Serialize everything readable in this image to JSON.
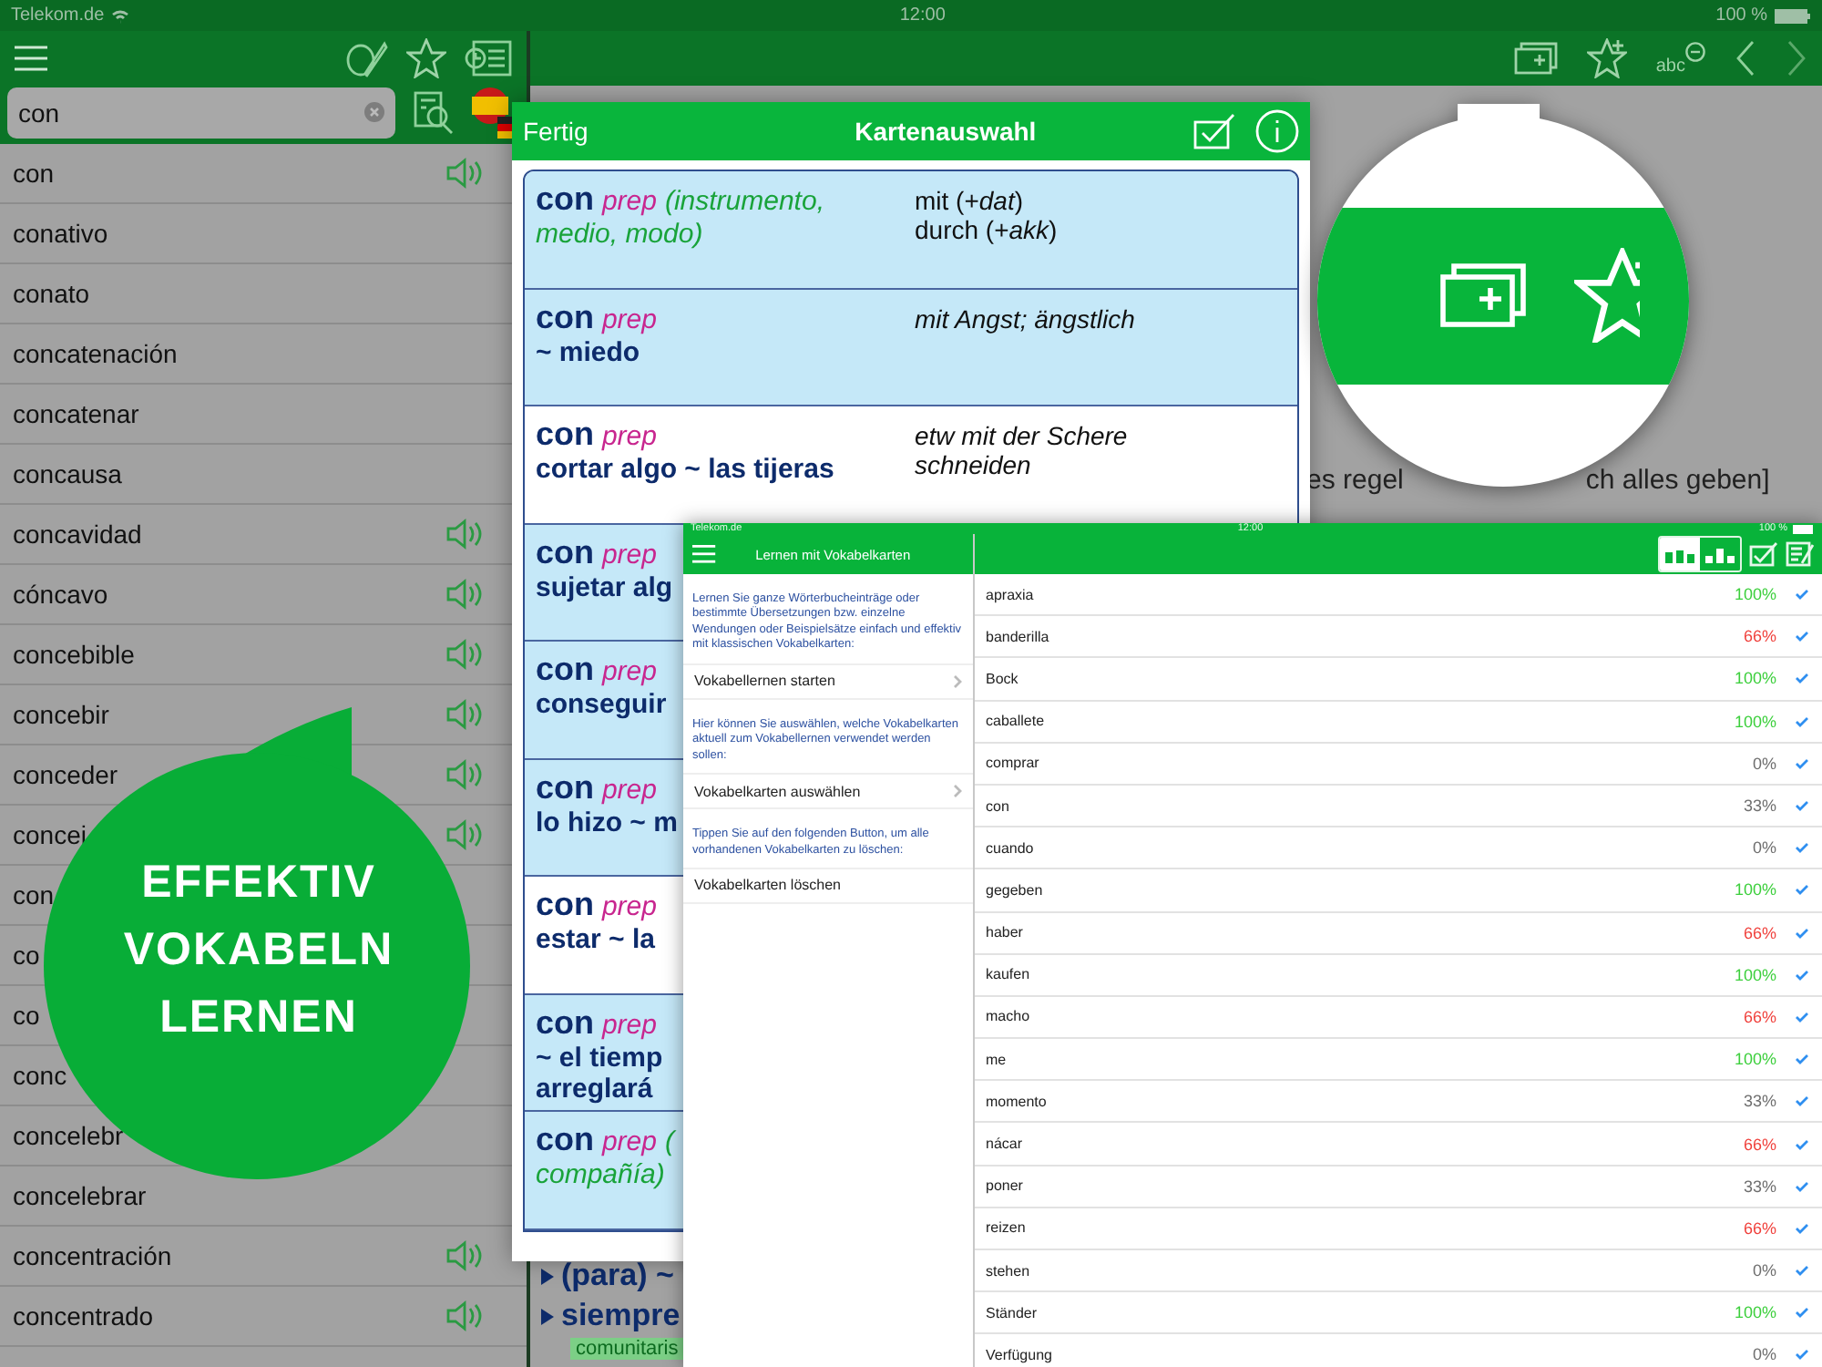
{
  "status_bar": {
    "carrier": "Telekom.de",
    "time": "12:00",
    "battery": "100 %"
  },
  "sidebar": {
    "search": {
      "value": "con"
    },
    "entries": [
      {
        "word": "con",
        "audio": true
      },
      {
        "word": "conativo",
        "audio": false
      },
      {
        "word": "conato",
        "audio": false
      },
      {
        "word": "concatenación",
        "audio": false
      },
      {
        "word": "concatenar",
        "audio": false
      },
      {
        "word": "concausa",
        "audio": false
      },
      {
        "word": "concavidad",
        "audio": true
      },
      {
        "word": "cóncavo",
        "audio": true
      },
      {
        "word": "concebible",
        "audio": true
      },
      {
        "word": "concebir",
        "audio": true
      },
      {
        "word": "conceder",
        "audio": true
      },
      {
        "word": "concej",
        "audio": true
      },
      {
        "word": "con",
        "audio": false
      },
      {
        "word": "co",
        "audio": false
      },
      {
        "word": "co",
        "audio": false
      },
      {
        "word": "conc",
        "audio": false
      },
      {
        "word": "concelebr",
        "audio": false
      },
      {
        "word": "concelebrar",
        "audio": false
      },
      {
        "word": "concentración",
        "audio": true
      },
      {
        "word": "concentrado",
        "audio": true
      }
    ]
  },
  "toolbar": {
    "text_size_label": "abc"
  },
  "article": {
    "fragments": [
      "es regel",
      "ch alles geben]"
    ],
    "bullets": [
      "(para) ~",
      "siempre"
    ],
    "tag": "comunitaris"
  },
  "card_dialog": {
    "done": "Fertig",
    "title": "Kartenauswahl",
    "cards": [
      {
        "word": "con",
        "pos": "prep",
        "sense": [
          "(instrumento,",
          "medio, modo)"
        ],
        "translation": [
          "mit (+*dat*)",
          "durch (+*akk*)"
        ],
        "italic": false,
        "selected": true
      },
      {
        "word": "con",
        "pos": "prep",
        "examples": [
          "~ miedo"
        ],
        "translation": [
          "mit Angst; ängstlich"
        ],
        "italic": true,
        "selected": true
      },
      {
        "word": "con",
        "pos": "prep",
        "examples": [
          "cortar algo ~ las tijeras"
        ],
        "translation": [
          "etw mit der Schere",
          "schneiden"
        ],
        "italic": true,
        "selected": false
      },
      {
        "word": "con",
        "pos": "prep",
        "examples": [
          "sujetar alg"
        ],
        "selected": true
      },
      {
        "word": "con",
        "pos": "prep",
        "examples": [
          "conseguir"
        ],
        "selected": true
      },
      {
        "word": "con",
        "pos": "prep",
        "examples": [
          "lo hizo ~ m"
        ],
        "selected": true
      },
      {
        "word": "con",
        "pos": "prep",
        "examples": [
          "estar ~ la"
        ],
        "selected": false
      },
      {
        "word": "con",
        "pos": "prep",
        "examples": [
          "~ el tiemp",
          "arreglará"
        ],
        "selected": true
      },
      {
        "word": "con",
        "pos": "prep",
        "sense": [
          "(",
          "compañía)"
        ],
        "selected": true
      }
    ]
  },
  "learning_screen": {
    "status_bar": {
      "carrier": "Telekom.de",
      "time": "12:00",
      "battery": "100 %"
    },
    "title": "Lernen mit Vokabelkarten",
    "sections": [
      {
        "note": "Lernen Sie ganze Wörterbucheinträge oder bestimmte Übersetzungen bzw. einzelne Wendungen oder Beispielsätze einfach und effektiv mit klassischen Vokabelkarten:",
        "action": "Vokabellernen starten",
        "disclosure": true
      },
      {
        "note": "Hier können Sie auswählen, welche Vokabelkarten aktuell zum Vokabellernen verwendet werden sollen:",
        "action": "Vokabelkarten auswählen",
        "disclosure": true
      },
      {
        "note": "Tippen Sie auf den folgenden Button, um alle vorhandenen Vokabelkarten zu löschen:",
        "action": "Vokabelkarten löschen",
        "disclosure": false
      }
    ],
    "view_modes": [
      {
        "selected": true
      },
      {
        "selected": false
      }
    ],
    "words": [
      {
        "word": "apraxia",
        "score": "100%",
        "color": "#3ccf3c",
        "checked": true
      },
      {
        "word": "banderilla",
        "score": "66%",
        "color": "#f0413c",
        "checked": true
      },
      {
        "word": "Bock",
        "score": "100%",
        "color": "#3ccf3c",
        "checked": true
      },
      {
        "word": "caballete",
        "score": "100%",
        "color": "#3ccf3c",
        "checked": true
      },
      {
        "word": "comprar",
        "score": "0%",
        "color": "#6e6e6e",
        "checked": true
      },
      {
        "word": "con",
        "score": "33%",
        "color": "#6e6e6e",
        "checked": true
      },
      {
        "word": "cuando",
        "score": "0%",
        "color": "#6e6e6e",
        "checked": true
      },
      {
        "word": "gegeben",
        "score": "100%",
        "color": "#3ccf3c",
        "checked": true
      },
      {
        "word": "haber",
        "score": "66%",
        "color": "#f0413c",
        "checked": true
      },
      {
        "word": "kaufen",
        "score": "100%",
        "color": "#3ccf3c",
        "checked": true
      },
      {
        "word": "macho",
        "score": "66%",
        "color": "#f0413c",
        "checked": true
      },
      {
        "word": "me",
        "score": "100%",
        "color": "#3ccf3c",
        "checked": true
      },
      {
        "word": "momento",
        "score": "33%",
        "color": "#6e6e6e",
        "checked": true
      },
      {
        "word": "nácar",
        "score": "66%",
        "color": "#f0413c",
        "checked": true
      },
      {
        "word": "poner",
        "score": "33%",
        "color": "#6e6e6e",
        "checked": true
      },
      {
        "word": "reizen",
        "score": "66%",
        "color": "#f0413c",
        "checked": true
      },
      {
        "word": "stehen",
        "score": "0%",
        "color": "#6e6e6e",
        "checked": true
      },
      {
        "word": "Ständer",
        "score": "100%",
        "color": "#3ccf3c",
        "checked": true
      },
      {
        "word": "Verfügung",
        "score": "0%",
        "color": "#6e6e6e",
        "checked": true
      }
    ]
  },
  "badge": {
    "lines": [
      "EFFEKTIV",
      "VOKABELN",
      "LERNEN"
    ]
  }
}
